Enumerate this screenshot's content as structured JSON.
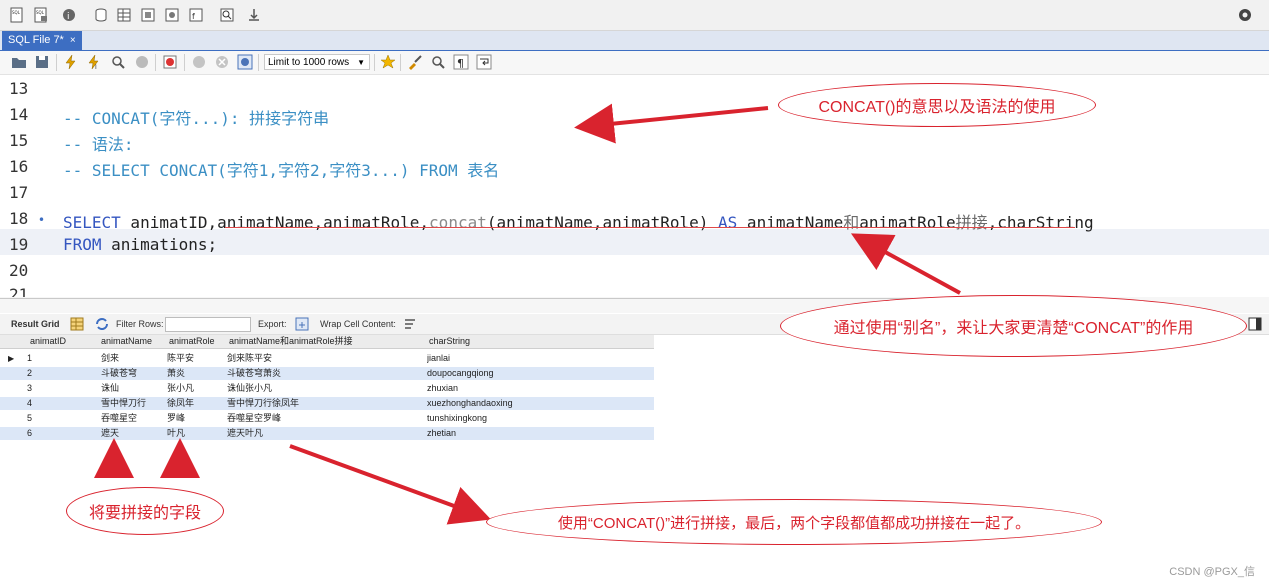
{
  "tab": {
    "title": "SQL File 7*",
    "close": "×"
  },
  "toolbar": {
    "limit_label": "Limit to 1000 rows"
  },
  "editor": {
    "lines": [
      {
        "num": "13"
      },
      {
        "num": "14",
        "text": "-- CONCAT(字符...): 拼接字符串"
      },
      {
        "num": "15",
        "text": "-- 语法:"
      },
      {
        "num": "16",
        "text": "-- SELECT CONCAT(字符1,字符2,字符3...) FROM 表名"
      },
      {
        "num": "17"
      },
      {
        "num": "18",
        "marker": "•"
      },
      {
        "num": "19"
      },
      {
        "num": "20"
      },
      {
        "num": "21"
      }
    ],
    "l18": {
      "kw1": "SELECT",
      "t1": " animatID,",
      "t2": "animatName,animatRole,",
      "fn": "concat",
      "t3": "(animatName,animatRole) ",
      "kw2": "AS",
      "t4": " animatName",
      "cn1": "和",
      "t5": "animatRole",
      "cn2": "拼接",
      "t6": ",charString"
    },
    "l19": {
      "kw": "FROM",
      "t": " animations;"
    }
  },
  "result_toolbar": {
    "result_grid": "Result Grid",
    "filter_rows": "Filter Rows:",
    "export": "Export:",
    "wrap": "Wrap Cell Content:"
  },
  "grid": {
    "columns": [
      "animatID",
      "animatName",
      "animatRole",
      "animatName和animatRole拼接",
      "charString"
    ],
    "rows": [
      [
        "1",
        "剑来",
        "陈平安",
        "剑来陈平安",
        "jianlai"
      ],
      [
        "2",
        "斗破苍穹",
        "萧炎",
        "斗破苍穹萧炎",
        "doupocangqiong"
      ],
      [
        "3",
        "诛仙",
        "张小凡",
        "诛仙张小凡",
        "zhuxian"
      ],
      [
        "4",
        "雪中悍刀行",
        "徐凤年",
        "雪中悍刀行徐凤年",
        "xuezhonghandaoxing"
      ],
      [
        "5",
        "吞噬星空",
        "罗峰",
        "吞噬星空罗峰",
        "tunshixingkong"
      ],
      [
        "6",
        "遮天",
        "叶凡",
        "遮天叶凡",
        "zhetian"
      ]
    ],
    "current_row_marker": "▶"
  },
  "annotations": {
    "c1": "CONCAT()的意思以及语法的使用",
    "c2": "通过使用“别名”，来让大家更清楚“CONCAT”的作用",
    "c3": "将要拼接的字段",
    "c4": "使用“CONCAT()”进行拼接，最后，两个字段都值都成功拼接在一起了。"
  },
  "watermark": "CSDN @PGX_信",
  "colors": {
    "annotation_red": "#d9232e",
    "tab_blue": "#3d6ec2",
    "comment_blue": "#3b8fc4",
    "keyword_blue": "#3456c0"
  }
}
